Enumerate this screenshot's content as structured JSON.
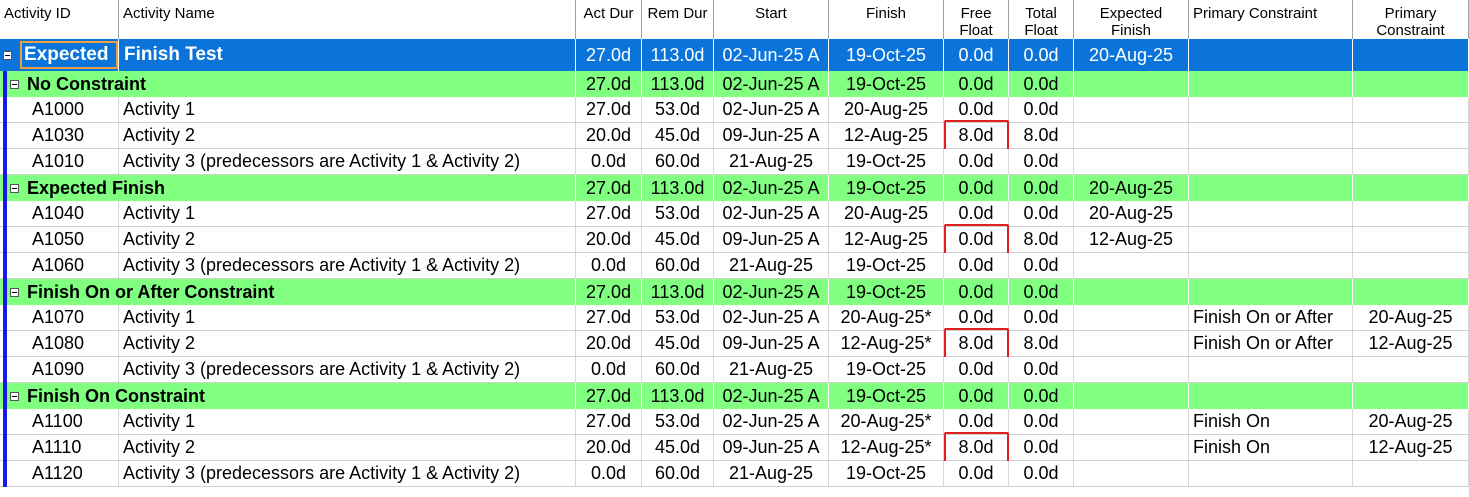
{
  "columns": {
    "activity_id": "Activity ID",
    "activity_name": "Activity Name",
    "act_dur": "Act Dur",
    "rem_dur": "Rem Dur",
    "start": "Start",
    "finish": "Finish",
    "free_float_1": "Free",
    "free_float_2": "Float",
    "total_float_1": "Total",
    "total_float_2": "Float",
    "expected_finish_1": "Expected",
    "expected_finish_2": "Finish",
    "primary_constraint": "Primary Constraint",
    "primary_constraint_date_1": "Primary",
    "primary_constraint_date_2": "Constraint"
  },
  "project": {
    "id": "Expected",
    "name": "Finish Test",
    "act_dur": "27.0d",
    "rem_dur": "113.0d",
    "start": "02-Jun-25 A",
    "finish": "19-Oct-25",
    "free_float": "0.0d",
    "total_float": "0.0d",
    "expected_finish": "20-Aug-25"
  },
  "rows": [
    {
      "type": "wbs",
      "name": "No Constraint",
      "act_dur": "27.0d",
      "rem_dur": "113.0d",
      "start": "02-Jun-25 A",
      "finish": "19-Oct-25",
      "free_float": "0.0d",
      "total_float": "0.0d",
      "expected_finish": "",
      "pc": "",
      "pcd": ""
    },
    {
      "type": "act",
      "id": "A1000",
      "name": "Activity 1",
      "act_dur": "27.0d",
      "rem_dur": "53.0d",
      "start": "02-Jun-25 A",
      "finish": "20-Aug-25",
      "free_float": "0.0d",
      "total_float": "0.0d",
      "expected_finish": "",
      "pc": "",
      "pcd": ""
    },
    {
      "type": "act",
      "id": "A1030",
      "name": "Activity 2",
      "act_dur": "20.0d",
      "rem_dur": "45.0d",
      "start": "09-Jun-25 A",
      "finish": "12-Aug-25",
      "free_float": "8.0d",
      "total_float": "8.0d",
      "expected_finish": "",
      "pc": "",
      "pcd": "",
      "highlight": true
    },
    {
      "type": "act",
      "id": "A1010",
      "name": "Activity 3 (predecessors are Activity 1 & Activity 2)",
      "act_dur": "0.0d",
      "rem_dur": "60.0d",
      "start": "21-Aug-25",
      "finish": "19-Oct-25",
      "free_float": "0.0d",
      "total_float": "0.0d",
      "expected_finish": "",
      "pc": "",
      "pcd": ""
    },
    {
      "type": "wbs",
      "name": "Expected Finish",
      "act_dur": "27.0d",
      "rem_dur": "113.0d",
      "start": "02-Jun-25 A",
      "finish": "19-Oct-25",
      "free_float": "0.0d",
      "total_float": "0.0d",
      "expected_finish": "20-Aug-25",
      "pc": "",
      "pcd": ""
    },
    {
      "type": "act",
      "id": "A1040",
      "name": "Activity 1",
      "act_dur": "27.0d",
      "rem_dur": "53.0d",
      "start": "02-Jun-25 A",
      "finish": "20-Aug-25",
      "free_float": "0.0d",
      "total_float": "0.0d",
      "expected_finish": "20-Aug-25",
      "pc": "",
      "pcd": ""
    },
    {
      "type": "act",
      "id": "A1050",
      "name": "Activity 2",
      "act_dur": "20.0d",
      "rem_dur": "45.0d",
      "start": "09-Jun-25 A",
      "finish": "12-Aug-25",
      "free_float": "0.0d",
      "total_float": "8.0d",
      "expected_finish": "12-Aug-25",
      "pc": "",
      "pcd": "",
      "highlight": true
    },
    {
      "type": "act",
      "id": "A1060",
      "name": "Activity 3 (predecessors are Activity 1 & Activity 2)",
      "act_dur": "0.0d",
      "rem_dur": "60.0d",
      "start": "21-Aug-25",
      "finish": "19-Oct-25",
      "free_float": "0.0d",
      "total_float": "0.0d",
      "expected_finish": "",
      "pc": "",
      "pcd": ""
    },
    {
      "type": "wbs",
      "name": "Finish On or After Constraint",
      "act_dur": "27.0d",
      "rem_dur": "113.0d",
      "start": "02-Jun-25 A",
      "finish": "19-Oct-25",
      "free_float": "0.0d",
      "total_float": "0.0d",
      "expected_finish": "",
      "pc": "",
      "pcd": ""
    },
    {
      "type": "act",
      "id": "A1070",
      "name": "Activity 1",
      "act_dur": "27.0d",
      "rem_dur": "53.0d",
      "start": "02-Jun-25 A",
      "finish": "20-Aug-25*",
      "free_float": "0.0d",
      "total_float": "0.0d",
      "expected_finish": "",
      "pc": "Finish On or After",
      "pcd": "20-Aug-25"
    },
    {
      "type": "act",
      "id": "A1080",
      "name": "Activity 2",
      "act_dur": "20.0d",
      "rem_dur": "45.0d",
      "start": "09-Jun-25 A",
      "finish": "12-Aug-25*",
      "free_float": "8.0d",
      "total_float": "8.0d",
      "expected_finish": "",
      "pc": "Finish On or After",
      "pcd": "12-Aug-25",
      "highlight": true
    },
    {
      "type": "act",
      "id": "A1090",
      "name": "Activity 3 (predecessors are Activity 1 & Activity 2)",
      "act_dur": "0.0d",
      "rem_dur": "60.0d",
      "start": "21-Aug-25",
      "finish": "19-Oct-25",
      "free_float": "0.0d",
      "total_float": "0.0d",
      "expected_finish": "",
      "pc": "",
      "pcd": ""
    },
    {
      "type": "wbs",
      "name": "Finish On Constraint",
      "act_dur": "27.0d",
      "rem_dur": "113.0d",
      "start": "02-Jun-25 A",
      "finish": "19-Oct-25",
      "free_float": "0.0d",
      "total_float": "0.0d",
      "expected_finish": "",
      "pc": "",
      "pcd": ""
    },
    {
      "type": "act",
      "id": "A1100",
      "name": "Activity 1",
      "act_dur": "27.0d",
      "rem_dur": "53.0d",
      "start": "02-Jun-25 A",
      "finish": "20-Aug-25*",
      "free_float": "0.0d",
      "total_float": "0.0d",
      "expected_finish": "",
      "pc": "Finish On",
      "pcd": "20-Aug-25"
    },
    {
      "type": "act",
      "id": "A1110",
      "name": "Activity 2",
      "act_dur": "20.0d",
      "rem_dur": "45.0d",
      "start": "09-Jun-25 A",
      "finish": "12-Aug-25*",
      "free_float": "8.0d",
      "total_float": "0.0d",
      "expected_finish": "",
      "pc": "Finish On",
      "pcd": "12-Aug-25",
      "highlight": true
    },
    {
      "type": "act",
      "id": "A1120",
      "name": "Activity 3 (predecessors are Activity 1 & Activity 2)",
      "act_dur": "0.0d",
      "rem_dur": "60.0d",
      "start": "21-Aug-25",
      "finish": "19-Oct-25",
      "free_float": "0.0d",
      "total_float": "0.0d",
      "expected_finish": "",
      "pc": "",
      "pcd": ""
    }
  ],
  "colors": {
    "project_band": "#0a74da",
    "wbs_band": "#80ff80",
    "wbs_bar": "#1a1ae6",
    "highlight_box": "#e02020",
    "selection_box": "#e8a040"
  }
}
